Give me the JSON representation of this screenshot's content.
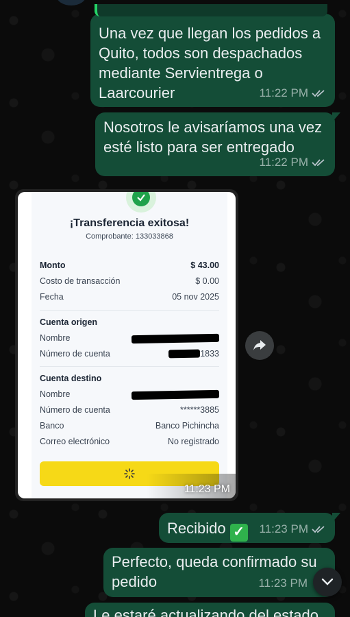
{
  "messages": [
    {
      "text": "Una vez que llegan los pedidos a Quito, todos son despachados mediante Servientrega o Laarcourier",
      "time": "11:22 PM"
    },
    {
      "text": "Nosotros le avisaríamos una vez esté listo para ser entregado",
      "time": "11:22 PM"
    },
    {
      "text": "Recibido",
      "emoji": "✓",
      "time": "11:23 PM"
    },
    {
      "text": "Perfecto, queda confirmado su pedido",
      "time": "11:23 PM"
    },
    {
      "text": "Le estaré actualizando del estado"
    }
  ],
  "image_message": {
    "time": "11:23 PM",
    "receipt": {
      "title": "¡Transferencia exitosa!",
      "comprobante": "Comprobante: 133033868",
      "monto_label": "Monto",
      "monto_value": "$ 43.00",
      "costo_label": "Costo de transacción",
      "costo_value": "$ 0.00",
      "fecha_label": "Fecha",
      "fecha_value": "05 nov 2025",
      "origen_section": "Cuenta origen",
      "origen_nombre_label": "Nombre",
      "origen_cuenta_label": "Número de cuenta",
      "origen_cuenta_value": "1833",
      "destino_section": "Cuenta destino",
      "destino_nombre_label": "Nombre",
      "destino_cuenta_label": "Número de cuenta",
      "destino_cuenta_value": "******3885",
      "banco_label": "Banco",
      "banco_value": "Banco Pichincha",
      "correo_label": "Correo electrónico",
      "correo_value": "No registrado"
    }
  },
  "icons": {
    "forward": "forward-icon",
    "scroll_down": "chevron-down-icon",
    "read_receipt": "double-check-icon",
    "success": "check-icon",
    "loading": "spinner-icon"
  },
  "colors": {
    "outgoing_bubble": "#144d37",
    "background": "#0b0b0b",
    "accent_green": "#25d366",
    "button_yellow": "#f6d917"
  }
}
